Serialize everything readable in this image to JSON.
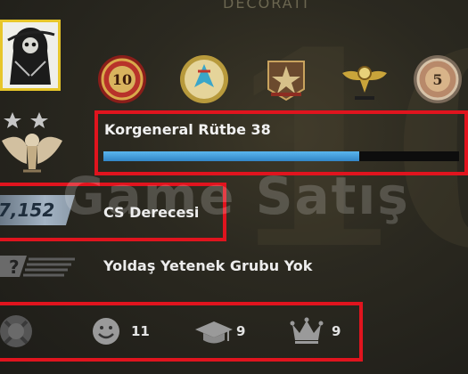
{
  "header": {
    "partial_title": "DECORATI"
  },
  "medals": [
    {
      "name": "10-year-veteran-coin-icon",
      "label": "10"
    },
    {
      "name": "operation-pin-icon",
      "label": ""
    },
    {
      "name": "star-badge-icon",
      "label": ""
    },
    {
      "name": "winged-emblem-icon",
      "label": ""
    },
    {
      "name": "5-year-veteran-coin-icon",
      "label": "5"
    }
  ],
  "rank": {
    "title": "Korgeneral Rütbe 38",
    "progress": 0.72,
    "bar_color": "#4aa8e8"
  },
  "skill": {
    "value": "7,152",
    "label": "CS Derecesi"
  },
  "wingman": {
    "label": "Yoldaş Yetenek Grubu Yok"
  },
  "commendations": {
    "friendly": "11",
    "teacher": "9",
    "leader": "9"
  },
  "watermark": {
    "text": "Game Satış"
  },
  "colors": {
    "highlight_border": "#e0141e",
    "avatar_border": "#e7c62a"
  }
}
